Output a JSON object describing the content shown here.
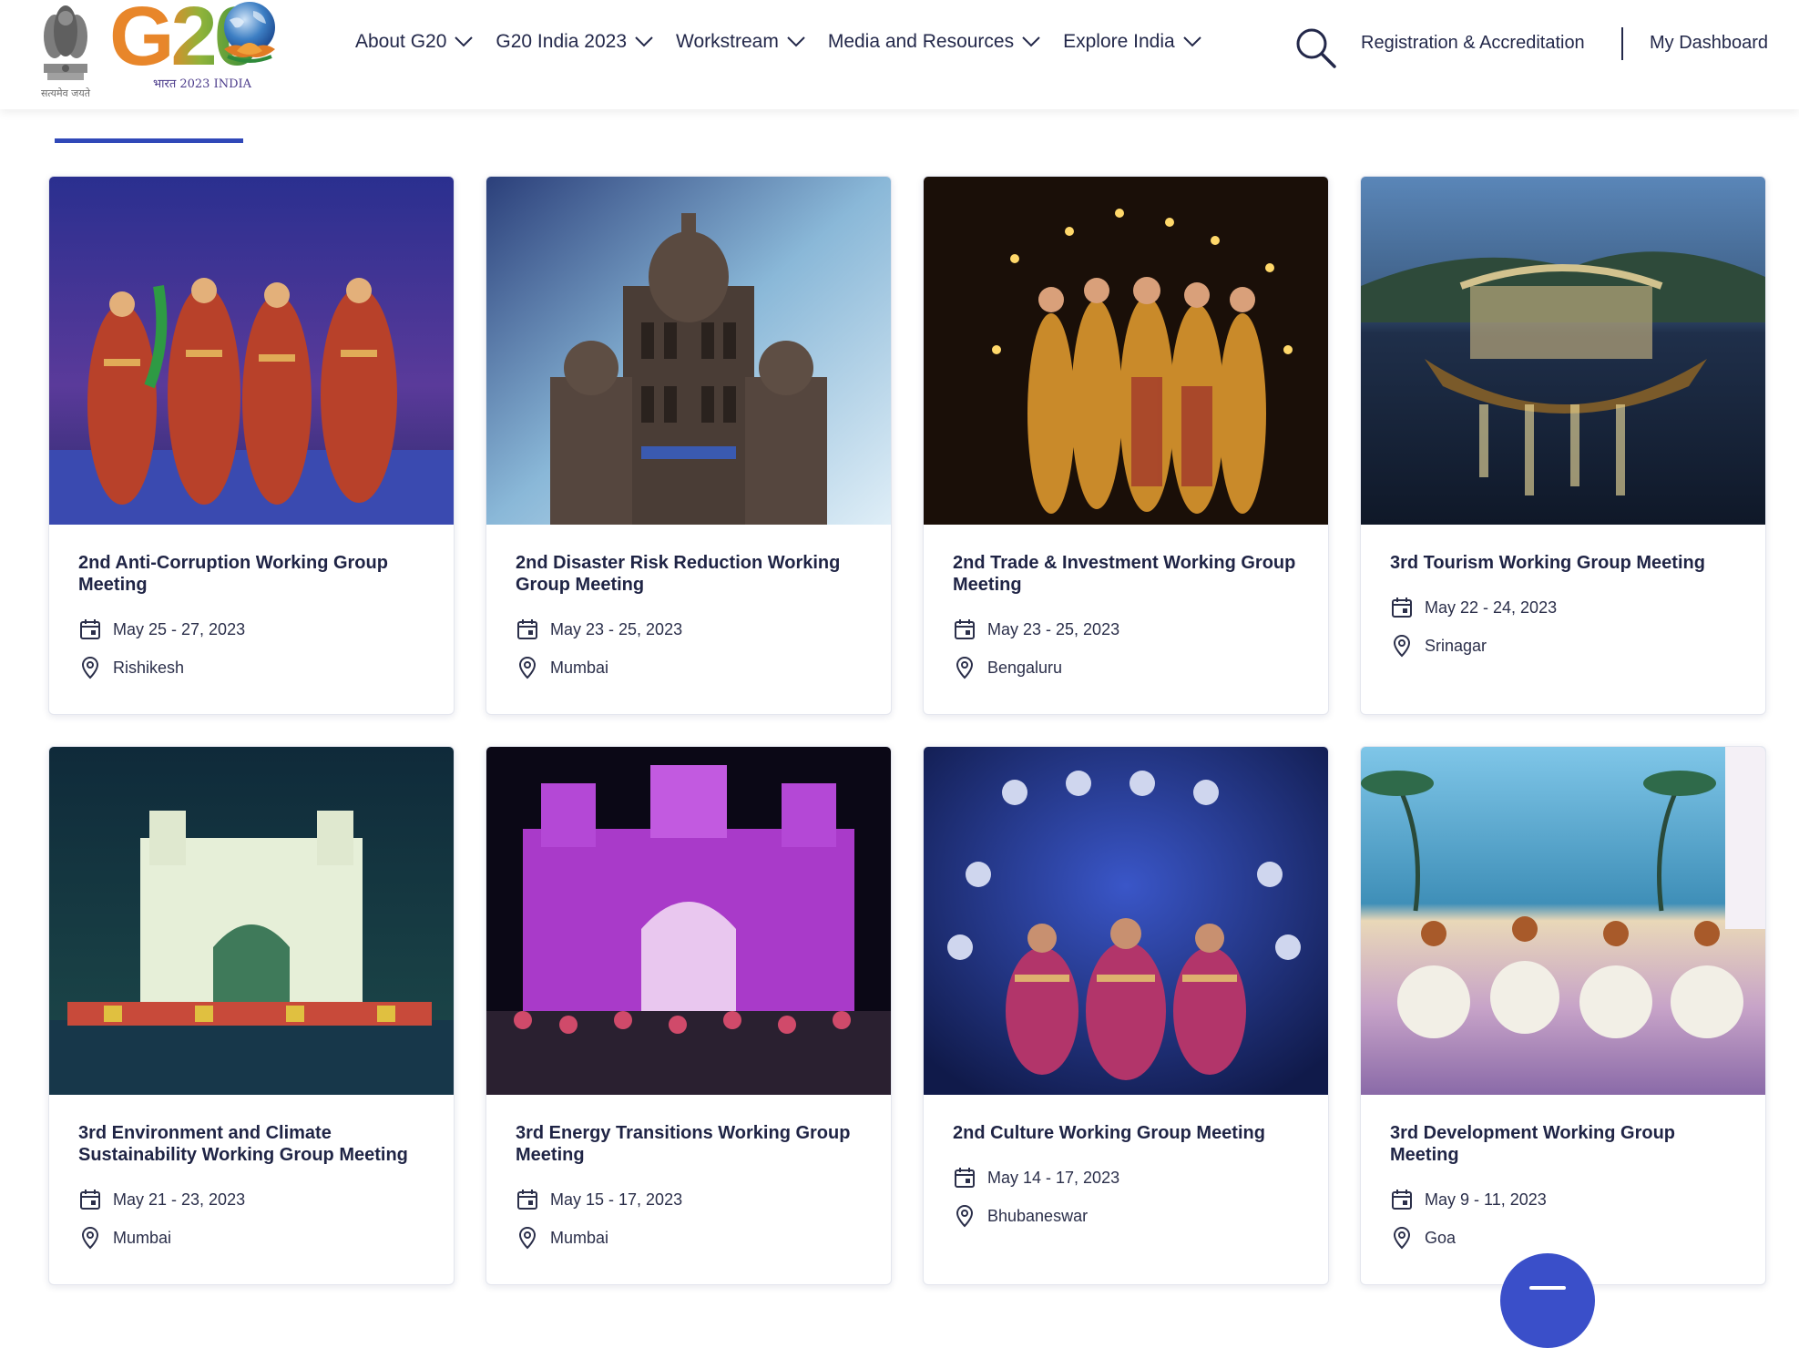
{
  "header": {
    "emblem_caption": "सत्यमेव जयते",
    "logo_text": "G20",
    "logo_tagline": "भारत 2023 INDIA",
    "nav": [
      {
        "label": "About G20"
      },
      {
        "label": "G20 India 2023"
      },
      {
        "label": "Workstream"
      },
      {
        "label": "Media and Resources"
      },
      {
        "label": "Explore India"
      }
    ],
    "registration_label": "Registration & Accreditation",
    "dashboard_label": "My Dashboard"
  },
  "colors": {
    "accent": "#3048b8",
    "fab": "#3a4fc9",
    "text": "#1f2445"
  },
  "icons": {
    "search": "search-icon",
    "date": "calendar-icon",
    "location": "location-pin-icon",
    "nav_chevron": "chevron-down-icon",
    "fab": "menu-icon"
  },
  "events": [
    {
      "title": "2nd Anti-Corruption Working Group Meeting",
      "date": "May 25 - 27, 2023",
      "location": "Rishikesh"
    },
    {
      "title": "2nd Disaster Risk Reduction Working Group Meeting",
      "date": "May 23 - 25, 2023",
      "location": "Mumbai"
    },
    {
      "title": "2nd Trade & Investment Working Group Meeting",
      "date": "May 23 - 25, 2023",
      "location": "Bengaluru"
    },
    {
      "title": "3rd Tourism Working Group Meeting",
      "date": "May 22 - 24, 2023",
      "location": "Srinagar"
    },
    {
      "title": "3rd Environment and Climate Sustainability Working Group Meeting",
      "date": "May 21 - 23, 2023",
      "location": "Mumbai"
    },
    {
      "title": "3rd Energy Transitions Working Group Meeting",
      "date": "May 15 - 17, 2023",
      "location": "Mumbai"
    },
    {
      "title": "2nd Culture Working Group Meeting",
      "date": "May 14 - 17, 2023",
      "location": "Bhubaneswar"
    },
    {
      "title": "3rd Development Working Group Meeting",
      "date": "May 9 - 11, 2023",
      "location": "Goa"
    }
  ]
}
